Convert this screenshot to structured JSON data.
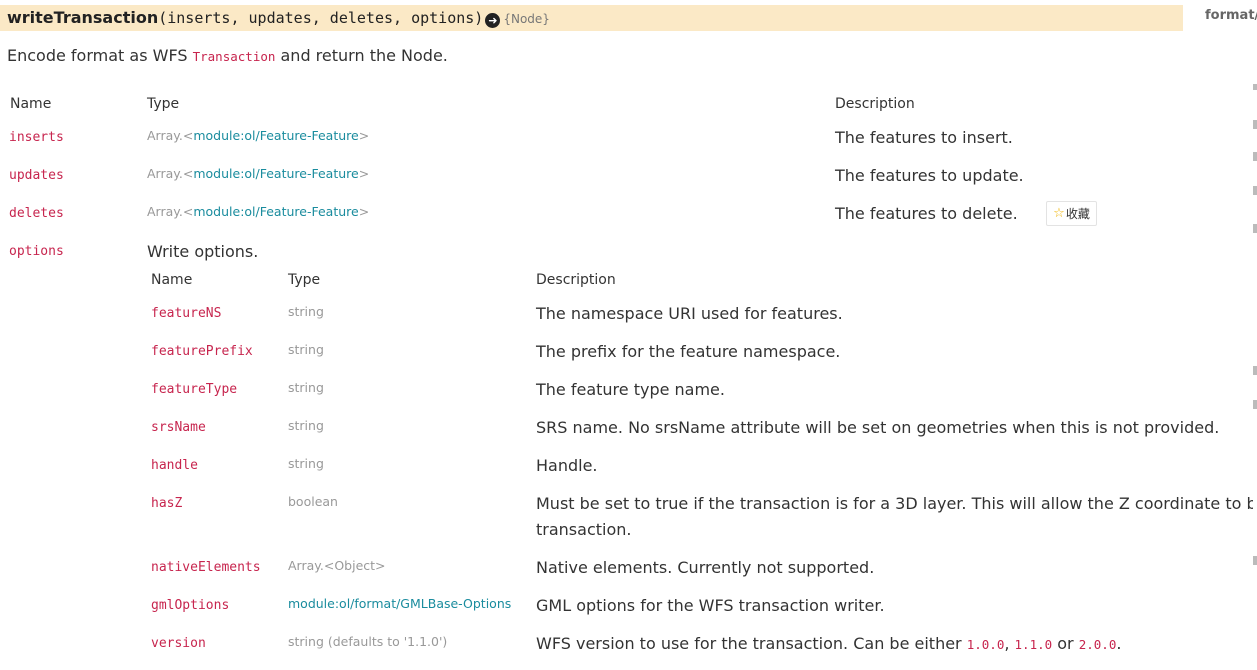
{
  "signature": {
    "name": "writeTransaction",
    "params": "(inserts, updates, deletes, options)",
    "arrow_icon": "arrow-right-circle-icon",
    "returns": "{Node}"
  },
  "source_link": "format/",
  "description": {
    "before": "Encode format as WFS ",
    "code": "Transaction",
    "after": " and return the Node."
  },
  "params_table": {
    "headers": {
      "name": "Name",
      "type": "Type",
      "description": "Description"
    },
    "rows": [
      {
        "name": "inserts",
        "type_prefix": "Array.<",
        "type_link": "module:ol/Feature-Feature",
        "type_suffix": ">",
        "description": "The features to insert."
      },
      {
        "name": "updates",
        "type_prefix": "Array.<",
        "type_link": "module:ol/Feature-Feature",
        "type_suffix": ">",
        "description": "The features to update."
      },
      {
        "name": "deletes",
        "type_prefix": "Array.<",
        "type_link": "module:ol/Feature-Feature",
        "type_suffix": ">",
        "description": "The features to delete."
      },
      {
        "name": "options",
        "description": "Write options."
      }
    ]
  },
  "favorite_button": {
    "label": "收藏",
    "icon": "star-icon"
  },
  "options_table": {
    "headers": {
      "name": "Name",
      "type": "Type",
      "description": "Description"
    },
    "rows": [
      {
        "name": "featureNS",
        "type": "string",
        "description": "The namespace URI used for features."
      },
      {
        "name": "featurePrefix",
        "type": "string",
        "description": "The prefix for the feature namespace."
      },
      {
        "name": "featureType",
        "type": "string",
        "description": "The feature type name."
      },
      {
        "name": "srsName",
        "type": "string",
        "description": "SRS name. No srsName attribute will be set on geometries when this is not provided."
      },
      {
        "name": "handle",
        "type": "string",
        "description": "Handle."
      },
      {
        "name": "hasZ",
        "type": "boolean",
        "description": "Must be set to true if the transaction is for a 3D layer. This will allow the Z coordinate to be includ",
        "description_line2": "transaction."
      },
      {
        "name": "nativeElements",
        "type": "Array.<Object>",
        "description": "Native elements. Currently not supported."
      },
      {
        "name": "gmlOptions",
        "type_link": "module:ol/format/GMLBase-Options",
        "description": "GML options for the WFS transaction writer."
      },
      {
        "name": "version",
        "type": "string (defaults to '1.1.0')",
        "description_before": "WFS version to use for the transaction. Can be either ",
        "v1": "1.0.0",
        "sep1": ", ",
        "v2": "1.1.0",
        "sep2": " or ",
        "v3": "2.0.0",
        "description_after": "."
      }
    ]
  }
}
